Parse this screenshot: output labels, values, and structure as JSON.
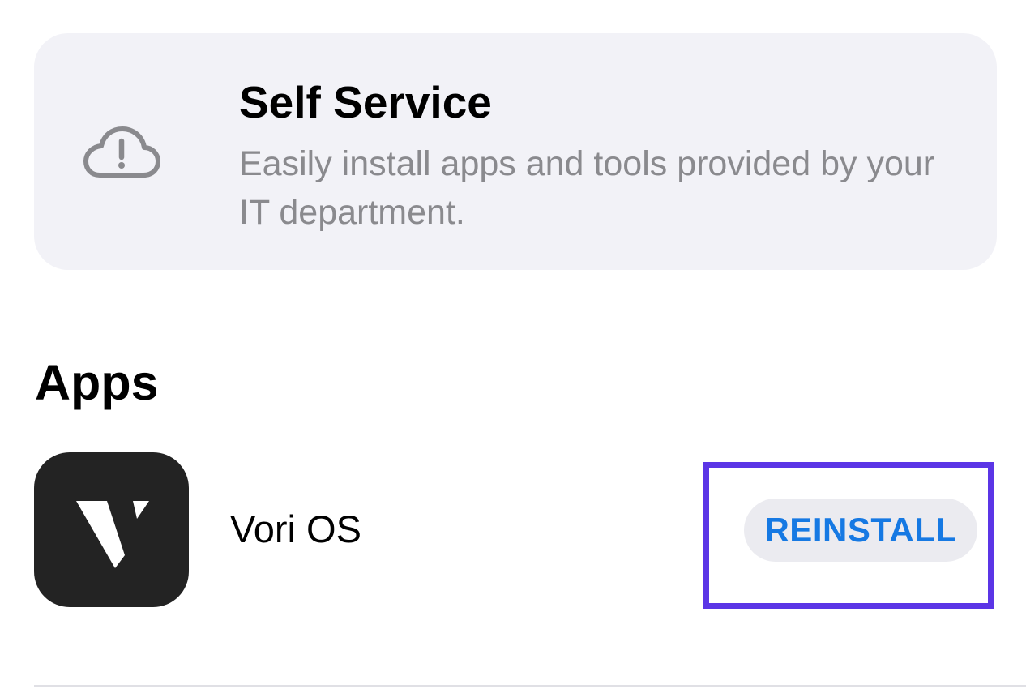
{
  "banner": {
    "icon": "cloud-exclamation-icon",
    "title": "Self Service",
    "description": "Easily install apps and tools provided by your IT department."
  },
  "apps_section": {
    "title": "Apps",
    "items": [
      {
        "name": "Vori OS",
        "icon": "vori-app-icon",
        "action_label": "REINSTALL"
      }
    ]
  },
  "colors": {
    "banner_background": "#f2f2f7",
    "secondary_text": "#8a8a8e",
    "accent_blue": "#1679e3",
    "button_background": "#ebebf0",
    "highlight_border": "#5b35e6",
    "app_icon_background": "#232323"
  }
}
